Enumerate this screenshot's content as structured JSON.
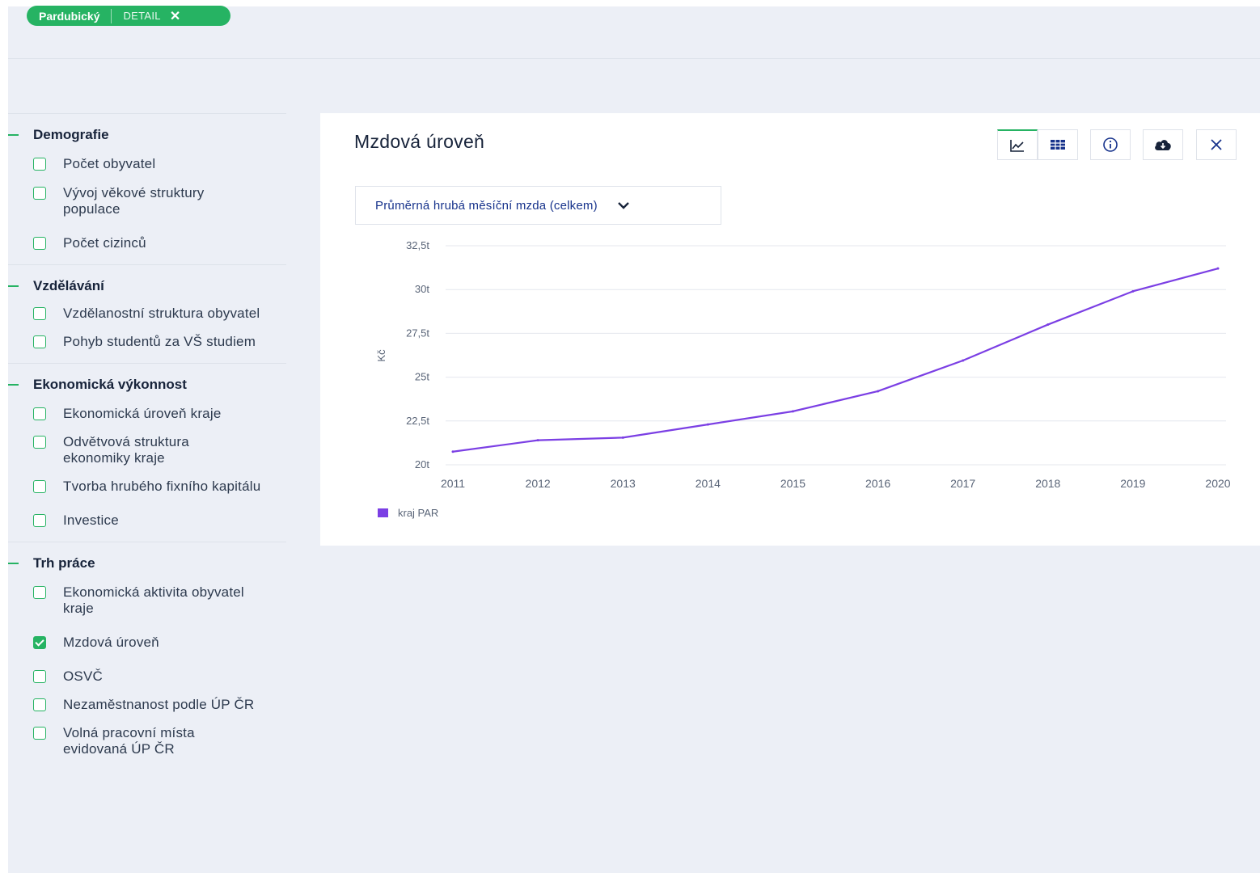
{
  "chip": {
    "region": "Pardubický",
    "detail": "DETAIL",
    "close": "✕"
  },
  "sidebar": {
    "sections": [
      {
        "title": "Demografie",
        "items": [
          "Počet obyvatel",
          "Vývoj věkové struktury populace",
          "Počet cizinců"
        ]
      },
      {
        "title": "Vzdělávání",
        "items": [
          "Vzdělanostní struktura obyvatel",
          "Pohyb studentů za VŠ studiem"
        ]
      },
      {
        "title": "Ekonomická výkonnost",
        "items": [
          "Ekonomická úroveň kraje",
          "Odvětvová struktura ekonomiky kraje",
          "Tvorba hrubého fixního kapitálu",
          "Investice"
        ]
      },
      {
        "title": "Trh práce",
        "items": [
          "Ekonomická aktivita obyvatel kraje",
          "Mzdová úroveň",
          "OSVČ",
          "Nezaměstnanost podle ÚP ČR",
          "Volná pracovní místa evidovaná ÚP ČR"
        ]
      }
    ],
    "checked_item": "Mzdová úroveň"
  },
  "panel": {
    "title": "Mzdová úroveň",
    "toolbar": [
      "line-chart-icon",
      "table-icon",
      "info-icon",
      "cloud-download-icon",
      "close-icon"
    ],
    "dropdown": "Průměrná hrubá měsíční mzda (celkem)"
  },
  "colors": {
    "accent": "#26b363",
    "series": "#7b3fe4",
    "bg": "#eceff6"
  },
  "chart_data": {
    "type": "line",
    "x": [
      "2011",
      "2012",
      "2013",
      "2014",
      "2015",
      "2016",
      "2017",
      "2018",
      "2019",
      "2020"
    ],
    "series": [
      {
        "name": "kraj PAR",
        "values": [
          20750,
          21400,
          21550,
          22300,
          23050,
          24200,
          25950,
          28000,
          29900,
          31200
        ]
      }
    ],
    "ylabel": "Kč",
    "ylim": [
      20000,
      32500
    ],
    "yticks": [
      20000,
      22500,
      25000,
      27500,
      30000,
      32500
    ],
    "ytick_labels": [
      "20t",
      "22,5t",
      "25t",
      "27,5t",
      "30t",
      "32,5t"
    ],
    "grid": true,
    "legend": "bottom-left"
  }
}
